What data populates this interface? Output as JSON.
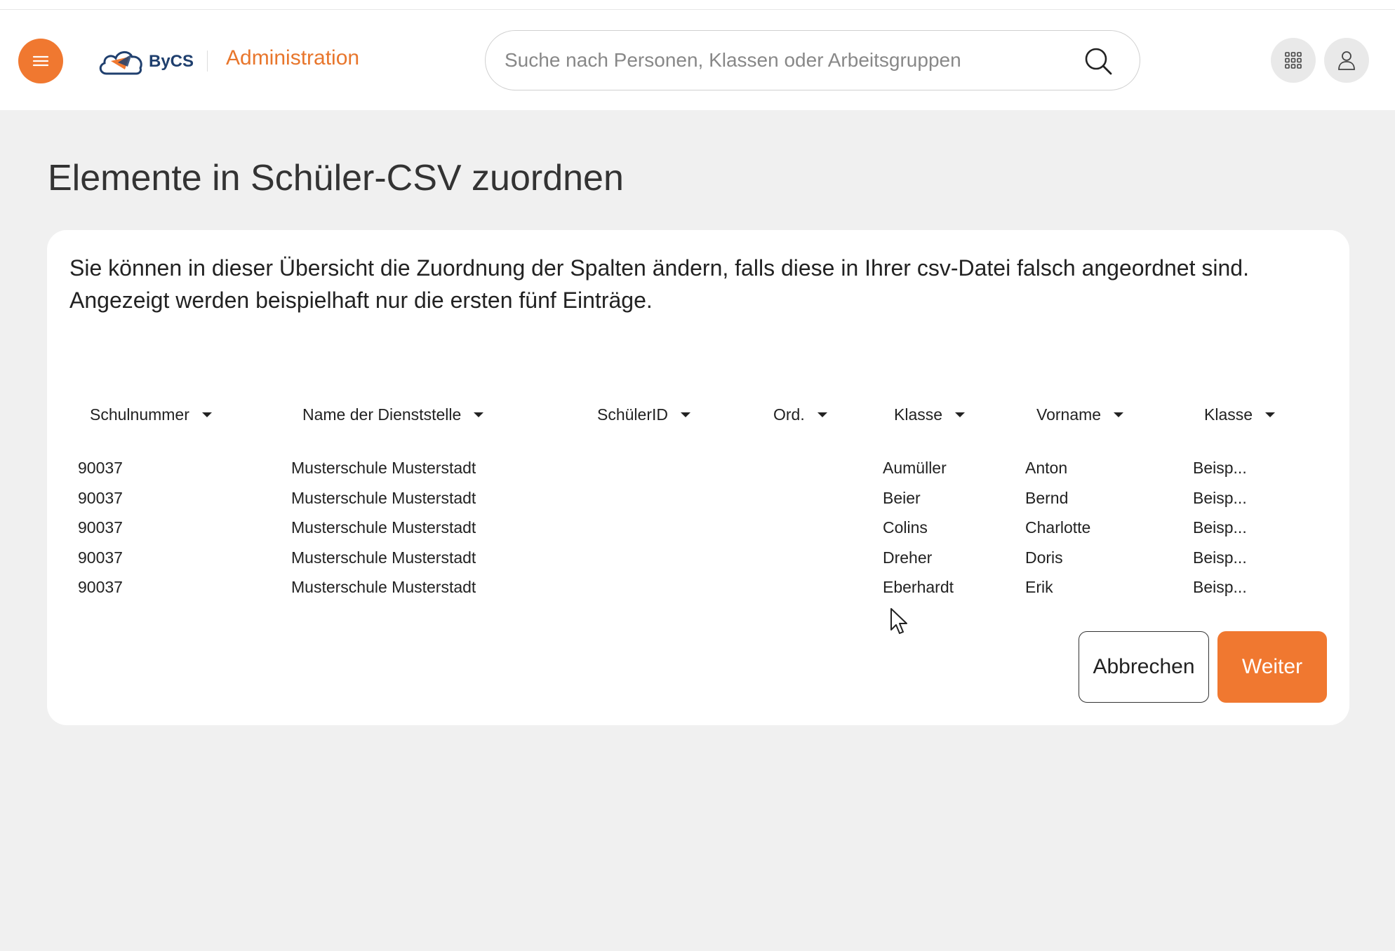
{
  "header": {
    "logo_text": "ByCS",
    "app_title": "Administration",
    "search_placeholder": "Suche nach Personen, Klassen oder Arbeitsgruppen"
  },
  "page": {
    "title": "Elemente in Schüler-CSV zuordnen",
    "intro": "Sie können in dieser Übersicht die Zuordnung der Spalten ändern, falls diese in Ihrer csv-Datei falsch angeordnet sind. Angezeigt werden beispielhaft nur die ersten fünf Einträge."
  },
  "table": {
    "columns": [
      "Schulnummer",
      "Name der Dienststelle",
      "SchülerID",
      "Ord.",
      "Klasse",
      "Vorname",
      "Klasse"
    ],
    "rows": [
      [
        "90037",
        "Musterschule Musterstadt",
        "",
        "",
        "Aumüller",
        "Anton",
        "Beisp..."
      ],
      [
        "90037",
        "Musterschule Musterstadt",
        "",
        "",
        "Beier",
        "Bernd",
        "Beisp..."
      ],
      [
        "90037",
        "Musterschule Musterstadt",
        "",
        "",
        "Colins",
        "Charlotte",
        "Beisp..."
      ],
      [
        "90037",
        "Musterschule Musterstadt",
        "",
        "",
        "Dreher",
        "Doris",
        "Beisp..."
      ],
      [
        "90037",
        "Musterschule Musterstadt",
        "",
        "",
        "Eberhardt",
        "Erik",
        "Beisp..."
      ]
    ]
  },
  "actions": {
    "cancel": "Abbrechen",
    "next": "Weiter"
  },
  "colors": {
    "accent": "#f07830",
    "brand_dark": "#1f3f6e"
  }
}
